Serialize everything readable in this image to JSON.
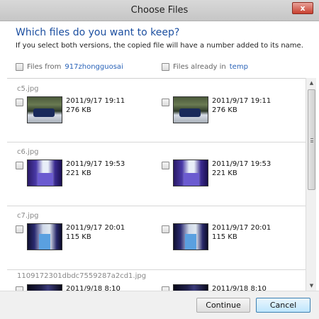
{
  "window": {
    "title": "Choose Files",
    "close_glyph": "x"
  },
  "heading": "Which files do you want to keep?",
  "subheading": "If you select both versions, the copied file will have a number added to its name.",
  "options": {
    "left": {
      "prefix": "Files from",
      "link": "917zhongguosai"
    },
    "right": {
      "prefix": "Files already in",
      "link": "temp"
    }
  },
  "groups": [
    {
      "name": "c5.jpg",
      "left": {
        "date": "2011/9/17 19:11",
        "size": "276 KB"
      },
      "right": {
        "date": "2011/9/17 19:11",
        "size": "276 KB"
      }
    },
    {
      "name": "c6.jpg",
      "left": {
        "date": "2011/9/17 19:53",
        "size": "221 KB"
      },
      "right": {
        "date": "2011/9/17 19:53",
        "size": "221 KB"
      }
    },
    {
      "name": "c7.jpg",
      "left": {
        "date": "2011/9/17 20:01",
        "size": "115 KB"
      },
      "right": {
        "date": "2011/9/17 20:01",
        "size": "115 KB"
      }
    },
    {
      "name": "1109172301dbdc7559287a2cd1.jpg",
      "left": {
        "date": "2011/9/18 8:10",
        "size": ""
      },
      "right": {
        "date": "2011/9/18 8:10",
        "size": ""
      }
    }
  ],
  "scrollbar": {
    "up_icon": "▲",
    "down_icon": "▼"
  },
  "buttons": {
    "continue": "Continue",
    "cancel": "Cancel"
  }
}
